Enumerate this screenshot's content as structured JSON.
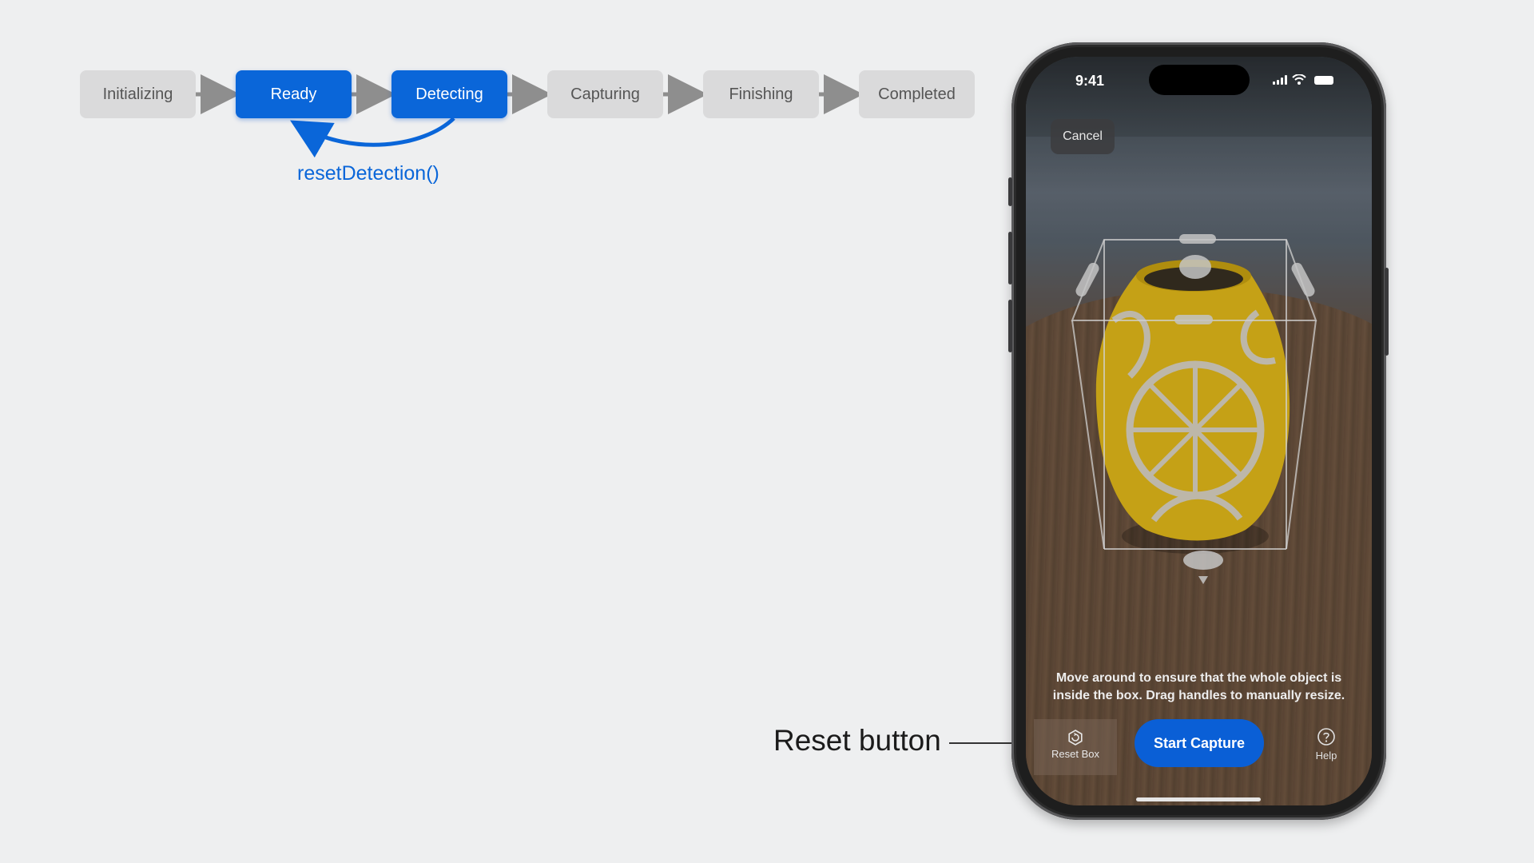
{
  "flow": {
    "states": [
      {
        "label": "Initializing",
        "active": false
      },
      {
        "label": "Ready",
        "active": true
      },
      {
        "label": "Detecting",
        "active": true
      },
      {
        "label": "Capturing",
        "active": false
      },
      {
        "label": "Finishing",
        "active": false
      },
      {
        "label": "Completed",
        "active": false
      }
    ],
    "loop_label": "resetDetection()"
  },
  "callout": {
    "label": "Reset button"
  },
  "phone": {
    "time": "9:41",
    "cancel_label": "Cancel",
    "instruction": "Move around to ensure that the whole object is inside the box. Drag handles to manually resize.",
    "reset_box_label": "Reset Box",
    "start_capture_label": "Start Capture",
    "help_label": "Help"
  },
  "colors": {
    "accent": "#0a66d9",
    "inactive": "#dadadb",
    "arrow": "#8e8e8e"
  },
  "icons": [
    "reset-box-icon",
    "help-icon",
    "signal-icon",
    "wifi-icon",
    "battery-icon"
  ]
}
